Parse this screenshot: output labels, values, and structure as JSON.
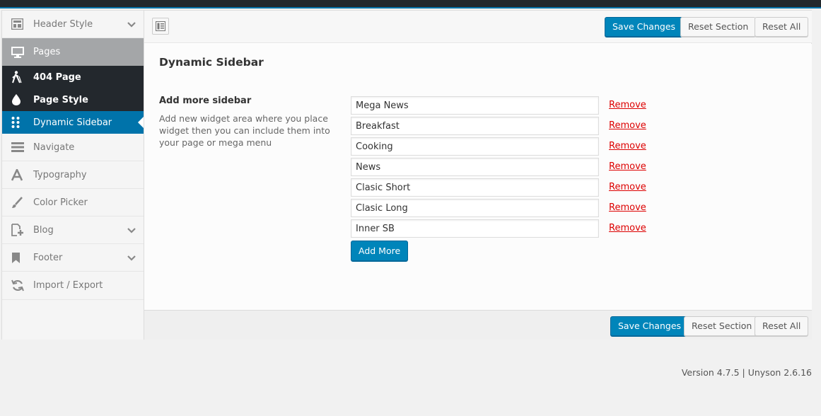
{
  "sidebar": {
    "items": [
      {
        "label": "Header Style",
        "icon": "layout-icon",
        "chevron": true
      },
      {
        "label": "Pages",
        "icon": "monitor-icon"
      },
      {
        "label": "404 Page",
        "icon": "walker-icon"
      },
      {
        "label": "Page Style",
        "icon": "drop-icon"
      },
      {
        "label": "Dynamic Sidebar",
        "icon": "dots-grid-icon"
      },
      {
        "label": "Navigate",
        "icon": "menu-bars-icon"
      },
      {
        "label": "Typography",
        "icon": "letter-a-icon"
      },
      {
        "label": "Color Picker",
        "icon": "brush-icon"
      },
      {
        "label": "Blog",
        "icon": "page-plus-icon",
        "chevron": true
      },
      {
        "label": "Footer",
        "icon": "bookmark-icon",
        "chevron": true
      },
      {
        "label": "Import / Export",
        "icon": "refresh-icon"
      }
    ]
  },
  "toolbar": {
    "save_label": "Save Changes",
    "reset_section_label": "Reset Section",
    "reset_all_label": "Reset All"
  },
  "content": {
    "title": "Dynamic Sidebar",
    "option_label": "Add more sidebar",
    "option_desc": "Add new widget area where you place widget then you can include them into your page or mega menu",
    "entries": [
      "Mega News",
      "Breakfast",
      "Cooking",
      "News",
      "Clasic Short",
      "Clasic Long",
      "Inner SB"
    ],
    "remove_label": "Remove",
    "add_more_label": "Add More"
  },
  "footer": {
    "save_label": "Save Changes",
    "reset_section_label": "Reset Section",
    "reset_all_label": "Reset All"
  },
  "version_text": "Version 4.7.5 | Unyson 2.6.16",
  "colors": {
    "primary": "#0085ba",
    "admin_dark": "#23282d",
    "active_blue": "#0073aa",
    "remove_red": "#dd0000"
  }
}
